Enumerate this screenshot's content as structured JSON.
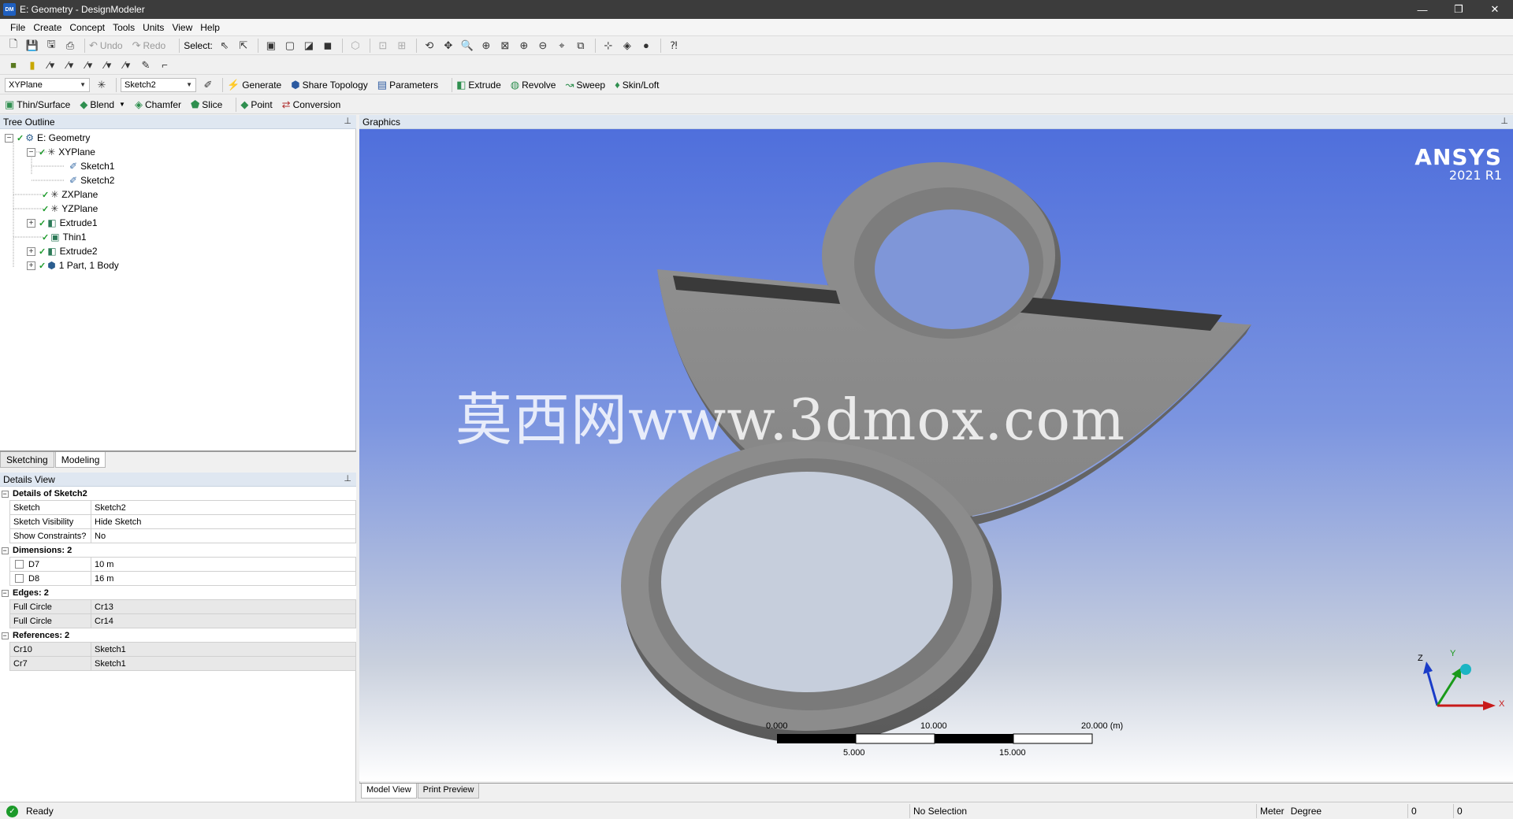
{
  "window": {
    "title": "E: Geometry - DesignModeler",
    "app_icon": "DM"
  },
  "menu": [
    "File",
    "Create",
    "Concept",
    "Tools",
    "Units",
    "View",
    "Help"
  ],
  "toolbar1": {
    "undo": "Undo",
    "redo": "Redo",
    "select": "Select:"
  },
  "toolbar3": {
    "plane_combo": "XYPlane",
    "sketch_combo": "Sketch2",
    "generate": "Generate",
    "share_topology": "Share Topology",
    "parameters": "Parameters",
    "extrude": "Extrude",
    "revolve": "Revolve",
    "sweep": "Sweep",
    "skin_loft": "Skin/Loft"
  },
  "toolbar4": {
    "thin_surface": "Thin/Surface",
    "blend": "Blend",
    "chamfer": "Chamfer",
    "slice": "Slice",
    "point": "Point",
    "conversion": "Conversion"
  },
  "tree": {
    "header": "Tree Outline",
    "items": [
      {
        "label": "E: Geometry"
      },
      {
        "label": "XYPlane"
      },
      {
        "label": "Sketch1"
      },
      {
        "label": "Sketch2"
      },
      {
        "label": "ZXPlane"
      },
      {
        "label": "YZPlane"
      },
      {
        "label": "Extrude1"
      },
      {
        "label": "Thin1"
      },
      {
        "label": "Extrude2"
      },
      {
        "label": "1 Part, 1 Body"
      }
    ]
  },
  "left_tabs": {
    "sketching": "Sketching",
    "modeling": "Modeling"
  },
  "details": {
    "header": "Details View",
    "group_main": "Details of Sketch2",
    "rows_main": [
      {
        "k": "Sketch",
        "v": "Sketch2"
      },
      {
        "k": "Sketch Visibility",
        "v": "Hide Sketch"
      },
      {
        "k": "Show Constraints?",
        "v": "No"
      }
    ],
    "group_dims": "Dimensions: 2",
    "rows_dims": [
      {
        "k": "D7",
        "v": "10 m"
      },
      {
        "k": "D8",
        "v": "16 m"
      }
    ],
    "group_edges": "Edges: 2",
    "rows_edges": [
      {
        "k": "Full Circle",
        "v": "Cr13"
      },
      {
        "k": "Full Circle",
        "v": "Cr14"
      }
    ],
    "group_refs": "References: 2",
    "rows_refs": [
      {
        "k": "Cr10",
        "v": "Sketch1"
      },
      {
        "k": "Cr7",
        "v": "Sketch1"
      }
    ]
  },
  "graphics": {
    "header": "Graphics",
    "brand": "ANSYS",
    "version": "2021 R1",
    "watermark": "莫西网www.3dmox.com",
    "scale": {
      "t0": "0.000",
      "t10": "10.000",
      "t20": "20.000 (m)",
      "t5": "5.000",
      "t15": "15.000"
    },
    "axes": {
      "z": "Z",
      "y": "Y",
      "x": "X"
    }
  },
  "bottom_tabs": {
    "model_view": "Model View",
    "print_preview": "Print Preview"
  },
  "status": {
    "ready": "Ready",
    "selection": "No Selection",
    "unit_length": "Meter",
    "unit_angle": "Degree",
    "v1": "0",
    "v2": "0"
  }
}
